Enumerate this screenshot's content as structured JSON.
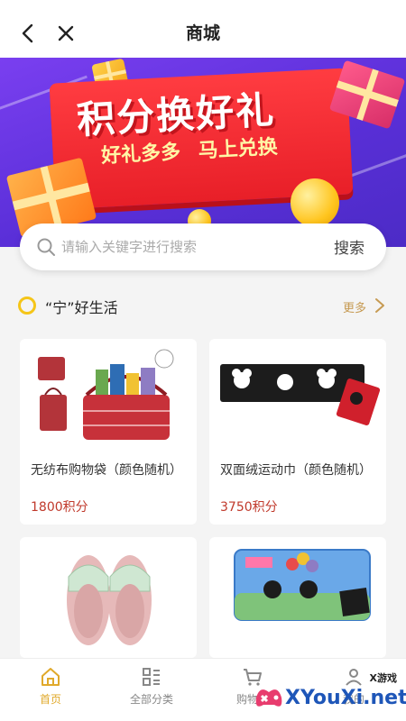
{
  "header": {
    "title": "商城"
  },
  "banner": {
    "headline": "积分换好礼",
    "subline": "好礼多多 马上兑换"
  },
  "search": {
    "placeholder": "请输入关键字进行搜索",
    "button": "搜索"
  },
  "section": {
    "title": "“宁”好生活",
    "more": "更多"
  },
  "products": [
    {
      "name": "无纺布购物袋（颜色随机）",
      "price": "1800积分"
    },
    {
      "name": "双面绒运动巾（颜色随机）",
      "price": "3750积分"
    },
    {
      "name": "",
      "price": ""
    },
    {
      "name": "",
      "price": ""
    }
  ],
  "tabbar": {
    "items": [
      {
        "label": "首页",
        "icon": "home-icon",
        "active": true
      },
      {
        "label": "全部分类",
        "icon": "category-icon",
        "active": false
      },
      {
        "label": "购物车",
        "icon": "cart-icon",
        "active": false
      },
      {
        "label": "我的",
        "icon": "user-icon",
        "active": false
      }
    ]
  },
  "watermark": {
    "small": "X游戏",
    "big": "XYouXi.net"
  },
  "colors": {
    "accent": "#e0a92b",
    "price": "#c0392b",
    "banner_purple": "#5a2fd8",
    "banner_red": "#e81f28"
  }
}
